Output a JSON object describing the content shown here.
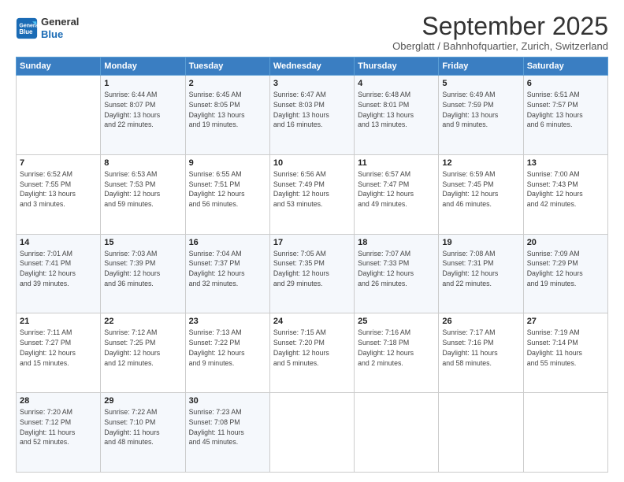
{
  "header": {
    "logo_line1": "General",
    "logo_line2": "Blue",
    "month": "September 2025",
    "location": "Oberglatt / Bahnhofquartier, Zurich, Switzerland"
  },
  "weekdays": [
    "Sunday",
    "Monday",
    "Tuesday",
    "Wednesday",
    "Thursday",
    "Friday",
    "Saturday"
  ],
  "weeks": [
    [
      {
        "day": "",
        "info": ""
      },
      {
        "day": "1",
        "info": "Sunrise: 6:44 AM\nSunset: 8:07 PM\nDaylight: 13 hours\nand 22 minutes."
      },
      {
        "day": "2",
        "info": "Sunrise: 6:45 AM\nSunset: 8:05 PM\nDaylight: 13 hours\nand 19 minutes."
      },
      {
        "day": "3",
        "info": "Sunrise: 6:47 AM\nSunset: 8:03 PM\nDaylight: 13 hours\nand 16 minutes."
      },
      {
        "day": "4",
        "info": "Sunrise: 6:48 AM\nSunset: 8:01 PM\nDaylight: 13 hours\nand 13 minutes."
      },
      {
        "day": "5",
        "info": "Sunrise: 6:49 AM\nSunset: 7:59 PM\nDaylight: 13 hours\nand 9 minutes."
      },
      {
        "day": "6",
        "info": "Sunrise: 6:51 AM\nSunset: 7:57 PM\nDaylight: 13 hours\nand 6 minutes."
      }
    ],
    [
      {
        "day": "7",
        "info": "Sunrise: 6:52 AM\nSunset: 7:55 PM\nDaylight: 13 hours\nand 3 minutes."
      },
      {
        "day": "8",
        "info": "Sunrise: 6:53 AM\nSunset: 7:53 PM\nDaylight: 12 hours\nand 59 minutes."
      },
      {
        "day": "9",
        "info": "Sunrise: 6:55 AM\nSunset: 7:51 PM\nDaylight: 12 hours\nand 56 minutes."
      },
      {
        "day": "10",
        "info": "Sunrise: 6:56 AM\nSunset: 7:49 PM\nDaylight: 12 hours\nand 53 minutes."
      },
      {
        "day": "11",
        "info": "Sunrise: 6:57 AM\nSunset: 7:47 PM\nDaylight: 12 hours\nand 49 minutes."
      },
      {
        "day": "12",
        "info": "Sunrise: 6:59 AM\nSunset: 7:45 PM\nDaylight: 12 hours\nand 46 minutes."
      },
      {
        "day": "13",
        "info": "Sunrise: 7:00 AM\nSunset: 7:43 PM\nDaylight: 12 hours\nand 42 minutes."
      }
    ],
    [
      {
        "day": "14",
        "info": "Sunrise: 7:01 AM\nSunset: 7:41 PM\nDaylight: 12 hours\nand 39 minutes."
      },
      {
        "day": "15",
        "info": "Sunrise: 7:03 AM\nSunset: 7:39 PM\nDaylight: 12 hours\nand 36 minutes."
      },
      {
        "day": "16",
        "info": "Sunrise: 7:04 AM\nSunset: 7:37 PM\nDaylight: 12 hours\nand 32 minutes."
      },
      {
        "day": "17",
        "info": "Sunrise: 7:05 AM\nSunset: 7:35 PM\nDaylight: 12 hours\nand 29 minutes."
      },
      {
        "day": "18",
        "info": "Sunrise: 7:07 AM\nSunset: 7:33 PM\nDaylight: 12 hours\nand 26 minutes."
      },
      {
        "day": "19",
        "info": "Sunrise: 7:08 AM\nSunset: 7:31 PM\nDaylight: 12 hours\nand 22 minutes."
      },
      {
        "day": "20",
        "info": "Sunrise: 7:09 AM\nSunset: 7:29 PM\nDaylight: 12 hours\nand 19 minutes."
      }
    ],
    [
      {
        "day": "21",
        "info": "Sunrise: 7:11 AM\nSunset: 7:27 PM\nDaylight: 12 hours\nand 15 minutes."
      },
      {
        "day": "22",
        "info": "Sunrise: 7:12 AM\nSunset: 7:25 PM\nDaylight: 12 hours\nand 12 minutes."
      },
      {
        "day": "23",
        "info": "Sunrise: 7:13 AM\nSunset: 7:22 PM\nDaylight: 12 hours\nand 9 minutes."
      },
      {
        "day": "24",
        "info": "Sunrise: 7:15 AM\nSunset: 7:20 PM\nDaylight: 12 hours\nand 5 minutes."
      },
      {
        "day": "25",
        "info": "Sunrise: 7:16 AM\nSunset: 7:18 PM\nDaylight: 12 hours\nand 2 minutes."
      },
      {
        "day": "26",
        "info": "Sunrise: 7:17 AM\nSunset: 7:16 PM\nDaylight: 11 hours\nand 58 minutes."
      },
      {
        "day": "27",
        "info": "Sunrise: 7:19 AM\nSunset: 7:14 PM\nDaylight: 11 hours\nand 55 minutes."
      }
    ],
    [
      {
        "day": "28",
        "info": "Sunrise: 7:20 AM\nSunset: 7:12 PM\nDaylight: 11 hours\nand 52 minutes."
      },
      {
        "day": "29",
        "info": "Sunrise: 7:22 AM\nSunset: 7:10 PM\nDaylight: 11 hours\nand 48 minutes."
      },
      {
        "day": "30",
        "info": "Sunrise: 7:23 AM\nSunset: 7:08 PM\nDaylight: 11 hours\nand 45 minutes."
      },
      {
        "day": "",
        "info": ""
      },
      {
        "day": "",
        "info": ""
      },
      {
        "day": "",
        "info": ""
      },
      {
        "day": "",
        "info": ""
      }
    ]
  ]
}
